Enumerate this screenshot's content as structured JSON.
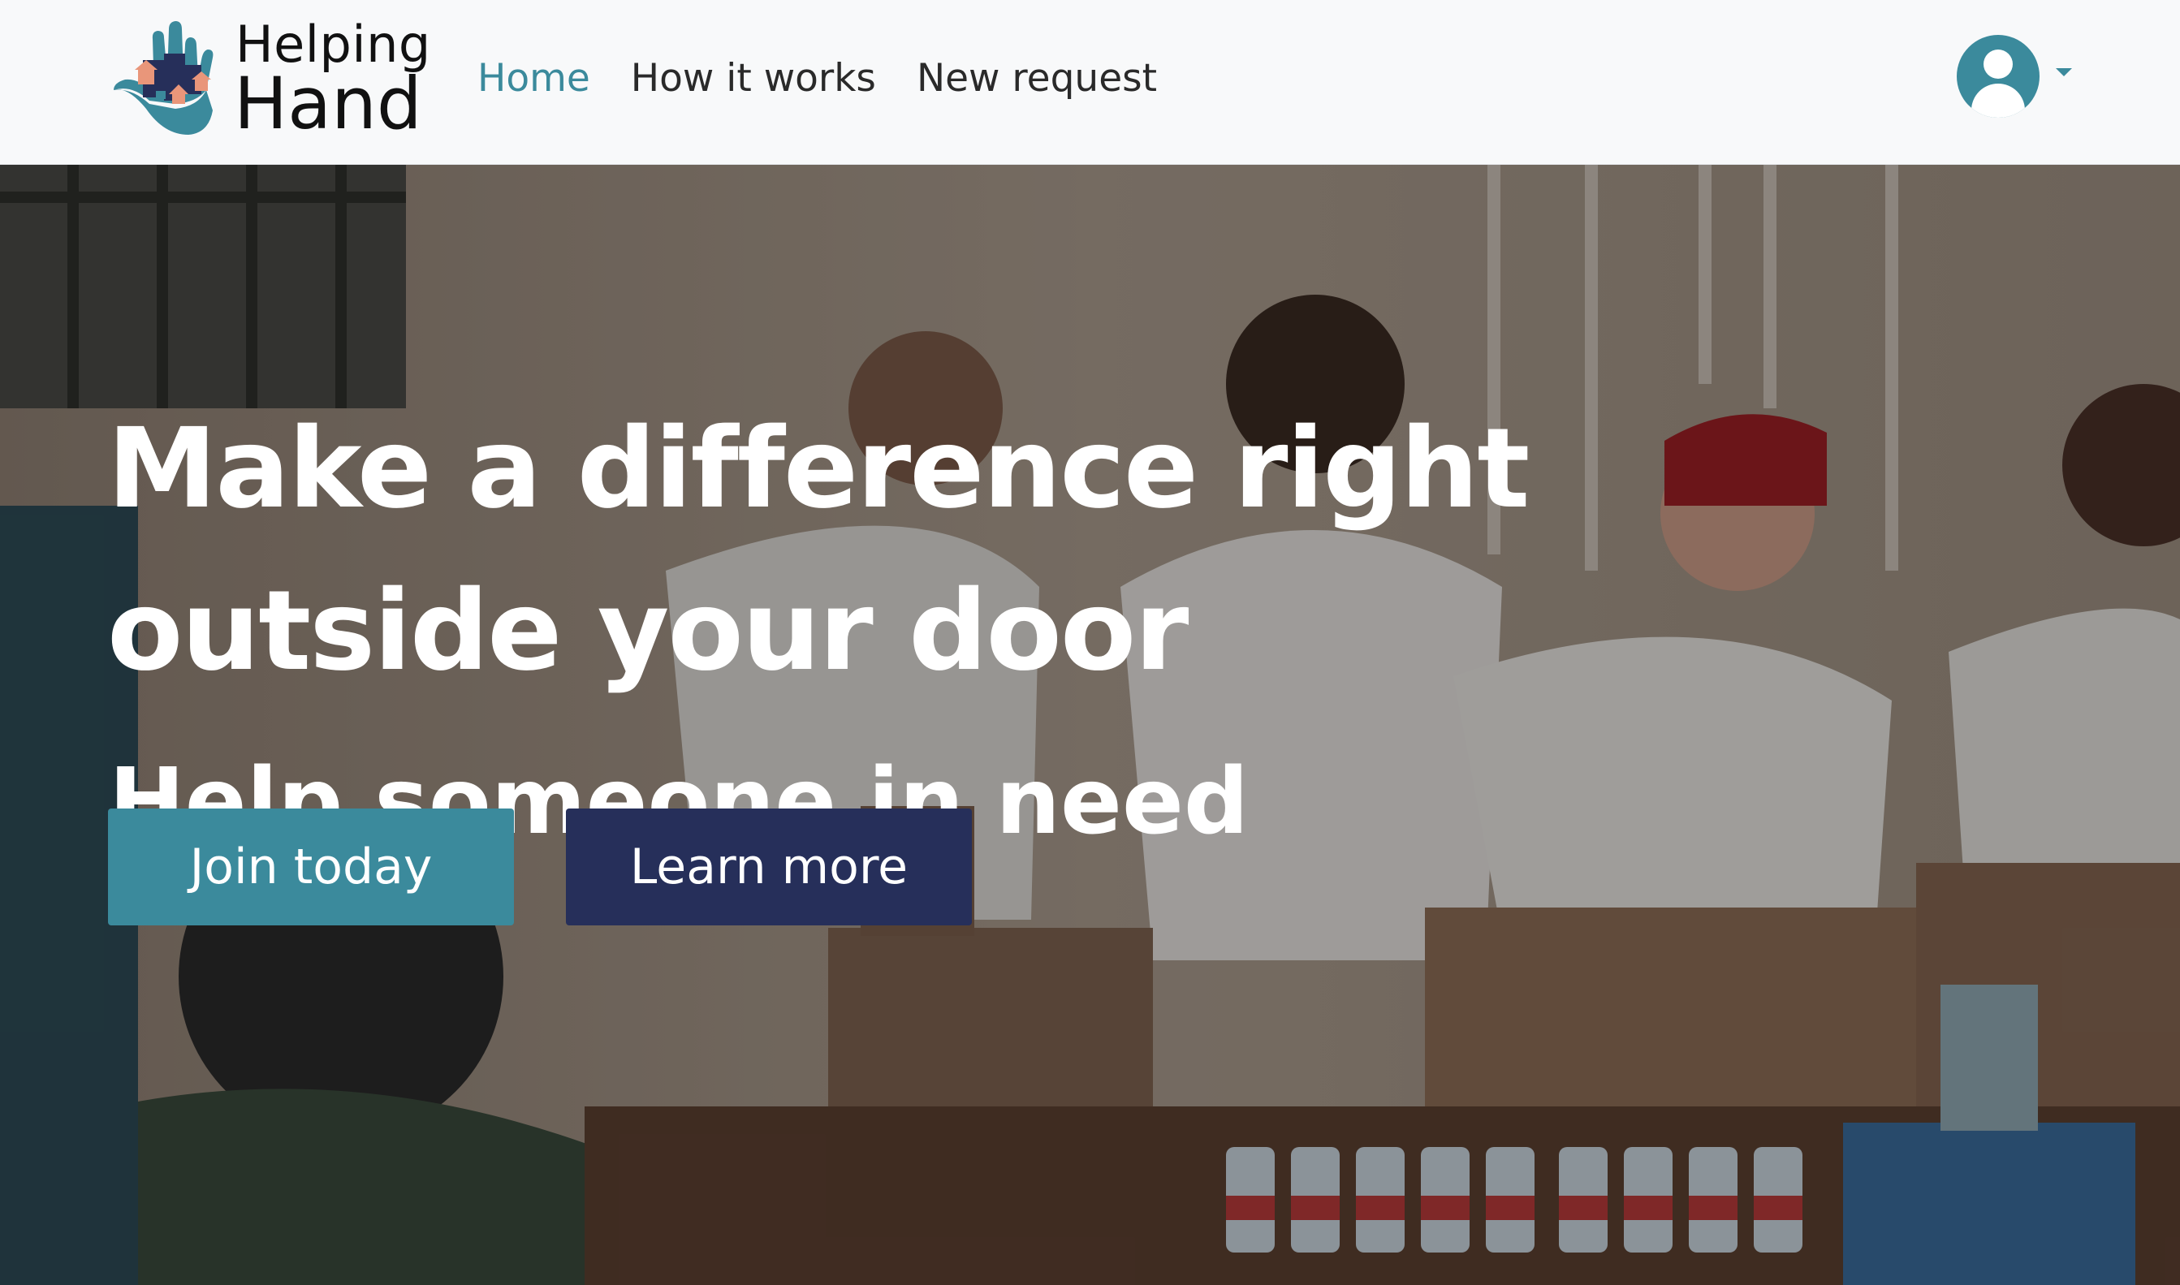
{
  "brand": {
    "line1": "Helping",
    "line2": "Hand",
    "logo_icon": "hand-with-houses-icon",
    "colors": {
      "hand": "#3b8a9c",
      "houses_dark": "#262f5a",
      "houses_accent": "#e9967a"
    }
  },
  "nav": {
    "items": [
      {
        "label": "Home",
        "active": true
      },
      {
        "label": "How it works",
        "active": false
      },
      {
        "label": "New request",
        "active": false
      }
    ],
    "user_icon": "user-avatar-icon",
    "caret_icon": "caret-down-icon"
  },
  "hero": {
    "headline_line1": "Make a difference right",
    "headline_line2": "outside your door",
    "subheadline": "Help someone in need",
    "primary_button": "Join today",
    "secondary_button": "Learn more"
  },
  "colors": {
    "accent": "#3b8a9c",
    "navy": "#262f5a",
    "navbar_bg": "#f8f9fa"
  }
}
